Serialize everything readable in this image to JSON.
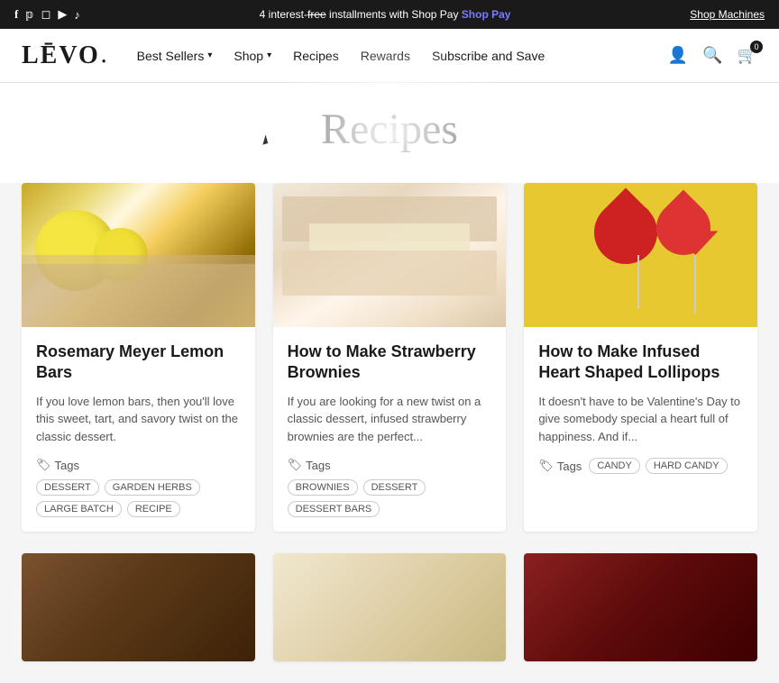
{
  "topbar": {
    "promo_text": "4 interest-",
    "promo_strikethrough": "free",
    "promo_suffix": " installments with Shop Pay",
    "shop_pay_label": "Shop Pay",
    "cta_label": "Shop Machines",
    "social_icons": [
      "facebook",
      "pinterest",
      "instagram",
      "youtube",
      "tiktok"
    ]
  },
  "header": {
    "logo": "LĒVO",
    "nav": [
      {
        "label": "Best Sellers",
        "has_dropdown": true
      },
      {
        "label": "Shop",
        "has_dropdown": true
      },
      {
        "label": "Recipes",
        "has_dropdown": false
      },
      {
        "label": "Rewards",
        "has_dropdown": false
      },
      {
        "label": "Subscribe and Save",
        "has_dropdown": false
      }
    ],
    "cart_count": "0"
  },
  "page": {
    "title": "Recipes"
  },
  "recipes": [
    {
      "id": "rosemary-lemon-bars",
      "title": "Rosemary Meyer Lemon Bars",
      "excerpt": "If you love lemon bars, then you'll love this sweet, tart, and savory twist on the classic dessert.",
      "tags": [
        "DESSERT",
        "GARDEN HERBS",
        "LARGE BATCH",
        "RECIPE"
      ],
      "image_type": "lemon"
    },
    {
      "id": "strawberry-brownies",
      "title": "How to Make Strawberry Brownies",
      "excerpt": "If you are looking for a new twist on a classic dessert, infused strawberry brownies are the perfect...",
      "tags": [
        "BROWNIES",
        "DESSERT",
        "DESSERT BARS"
      ],
      "image_type": "brownies"
    },
    {
      "id": "heart-lollipops",
      "title": "How to Make Infused Heart Shaped Lollipops",
      "excerpt": "It doesn't have to be Valentine's Day to give somebody special a heart full of happiness.  And if...",
      "tags": [
        "CANDY",
        "HARD CANDY"
      ],
      "image_type": "lollipops"
    }
  ],
  "bottom_recipes": [
    {
      "id": "bottom-1",
      "image_type": "dark"
    },
    {
      "id": "bottom-2",
      "image_type": "light"
    },
    {
      "id": "bottom-3",
      "image_type": "red"
    }
  ],
  "icons": {
    "tag": "🏷",
    "user": "👤",
    "search": "🔍",
    "cart": "🛒",
    "facebook": "f",
    "pinterest": "p",
    "instagram": "📷",
    "youtube": "▶",
    "tiktok": "♪"
  }
}
